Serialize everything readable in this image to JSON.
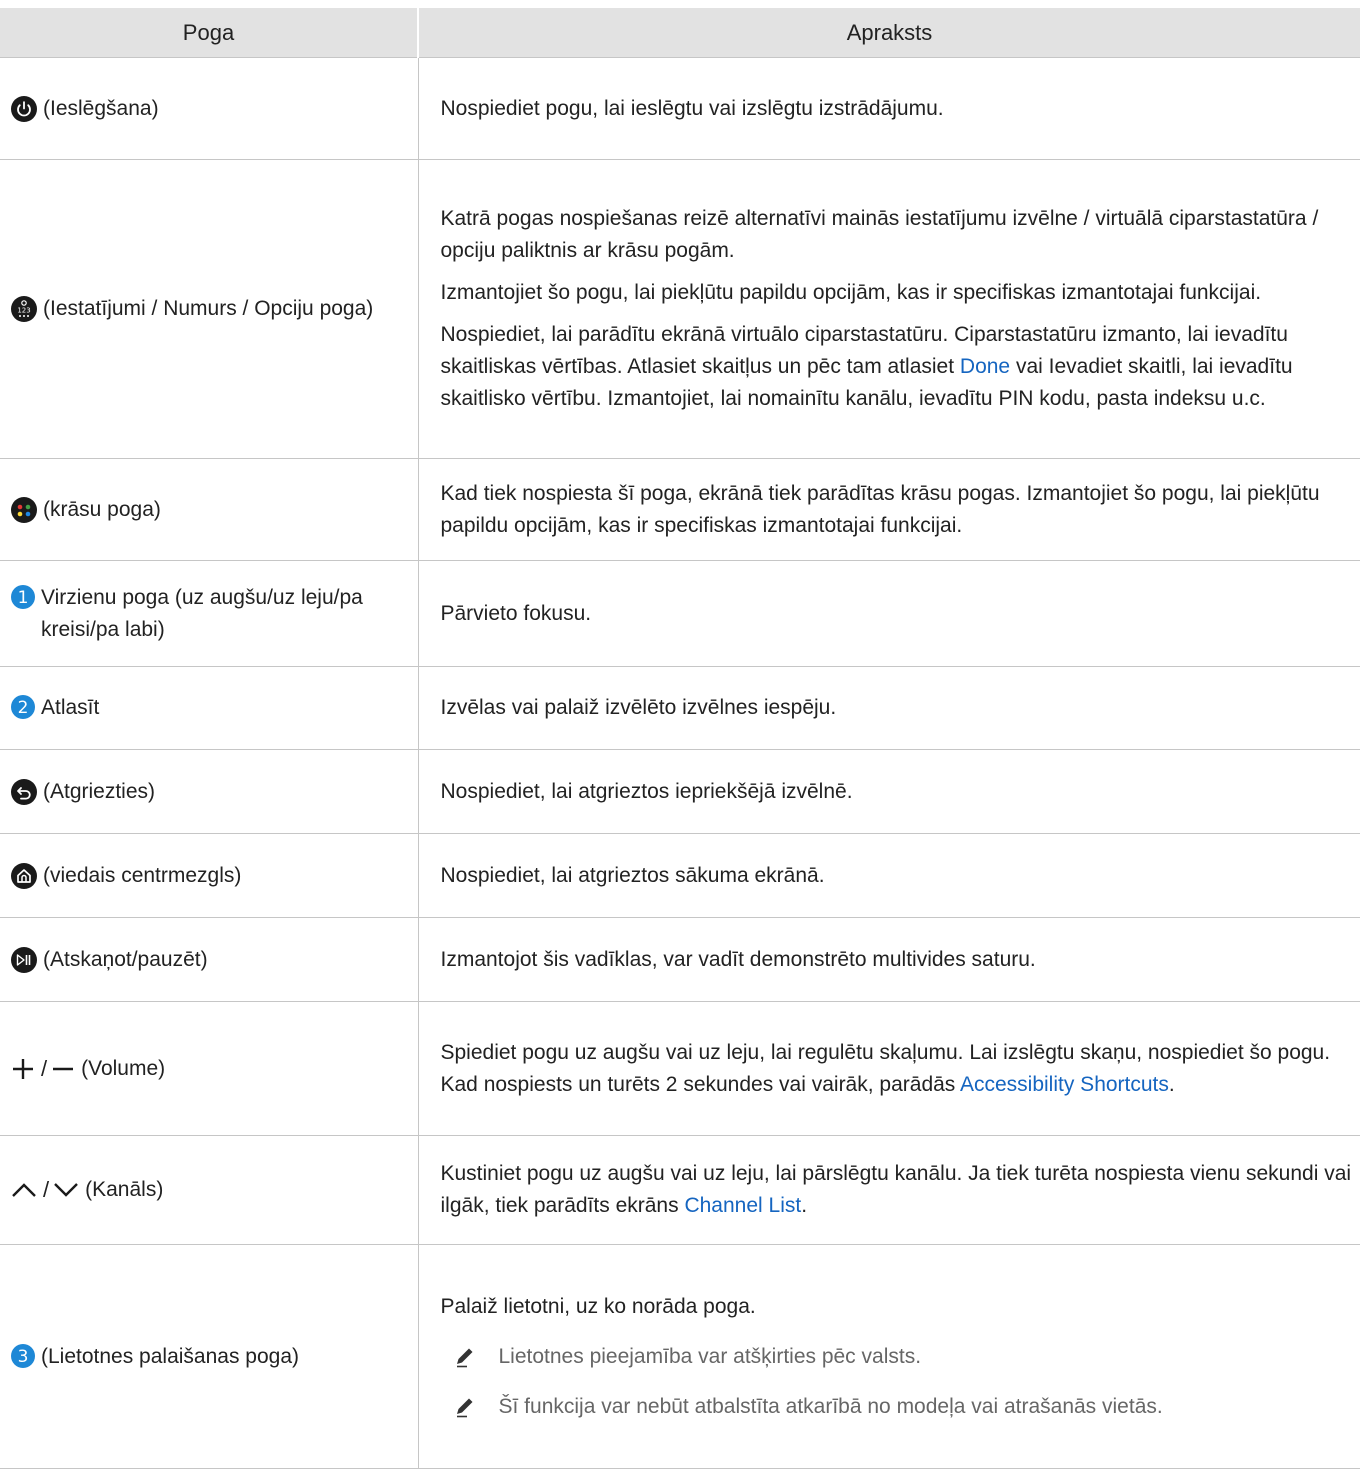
{
  "header": {
    "col_button": "Poga",
    "col_description": "Apraksts"
  },
  "rows": [
    {
      "label": "(Ieslēgšana)",
      "desc": [
        "Nospiediet pogu, lai ieslēgtu vai izslēgtu izstrādājumu."
      ]
    },
    {
      "label": "(Iestatījumi / Numurs / Opciju poga)",
      "desc": [
        "Katrā pogas nospiešanas reizē alternatīvi mainās iestatījumu izvēlne / virtuālā ciparstastatūra / opciju paliktnis ar krāsu pogām.",
        "Izmantojiet šo pogu, lai piekļūtu papildu opcijām, kas ir specifiskas izmantotajai funkcijai."
      ],
      "desc3_a": "Nospiediet, lai parādītu ekrānā virtuālo ciparstastatūru. Ciparstastatūru izmanto, lai ievadītu skaitliskas vērtības. Atlasiet skaitļus un pēc tam atlasiet ",
      "desc3_link": "Done",
      "desc3_b": " vai Ievadiet skaitli, lai ievadītu skaitlisko vērtību. Izmantojiet, lai nomainītu kanālu, ievadītu PIN kodu, pasta indeksu u.c."
    },
    {
      "label": "(krāsu poga)",
      "desc": [
        "Kad tiek nospiesta šī poga, ekrānā tiek parādītas krāsu pogas. Izmantojiet šo pogu, lai piekļūtu papildu opcijām, kas ir specifiskas izmantotajai funkcijai."
      ]
    },
    {
      "num": "1",
      "label": "Virzienu poga (uz augšu/uz leju/pa kreisi/pa labi)",
      "desc": [
        "Pārvieto fokusu."
      ]
    },
    {
      "num": "2",
      "label": "Atlasīt",
      "desc": [
        "Izvēlas vai palaiž izvēlēto izvēlnes iespēju."
      ]
    },
    {
      "label": "(Atgriezties)",
      "desc": [
        "Nospiediet, lai atgrieztos iepriekšējā izvēlnē."
      ]
    },
    {
      "label": "(viedais centrmezgls)",
      "desc": [
        "Nospiediet, lai atgrieztos sākuma ekrānā."
      ]
    },
    {
      "label": "(Atskaņot/pauzēt)",
      "desc": [
        "Izmantojot šis vadīklas, var vadīt demonstrēto multivides saturu."
      ]
    },
    {
      "symbol_sep": "/",
      "label": "(Volume)",
      "desc_a": "Spiediet pogu uz augšu vai uz leju, lai regulētu skaļumu. Lai izslēgtu skaņu, nospiediet šo pogu. Kad nospiests un turēts 2 sekundes vai vairāk, parādās ",
      "desc_link": "Accessibility Shortcuts",
      "desc_b": "."
    },
    {
      "symbol_sep": "/",
      "label": "(Kanāls)",
      "desc_a": "Kustiniet pogu uz augšu vai uz leju, lai pārslēgtu kanālu. Ja tiek turēta nospiesta vienu sekundi vai ilgāk, tiek parādīts ekrāns ",
      "desc_link": "Channel List",
      "desc_b": "."
    },
    {
      "num": "3",
      "label": "(Lietotnes palaišanas poga)",
      "desc": [
        "Palaiž lietotni, uz ko norāda poga."
      ],
      "notes": [
        "Lietotnes pieejamība var atšķirties pēc valsts.",
        "Šī funkcija var nebūt atbalstīta atkarībā no modeļa vai atrašanās vietās."
      ]
    }
  ],
  "icons": {
    "power": "power-icon",
    "settings_num": "settings-number-icon",
    "color": "color-button-icon",
    "back": "back-icon",
    "home": "home-icon",
    "play_pause": "play-pause-icon",
    "plus": "plus-icon",
    "minus": "minus-icon",
    "up": "chevron-up-icon",
    "down": "chevron-down-icon",
    "note": "pencil-note-icon"
  },
  "colors": {
    "badge_blue": "#1e88d6",
    "link": "#1565c0",
    "header_bg": "#e2e2e2",
    "icon_dark": "#1a1a1a"
  }
}
